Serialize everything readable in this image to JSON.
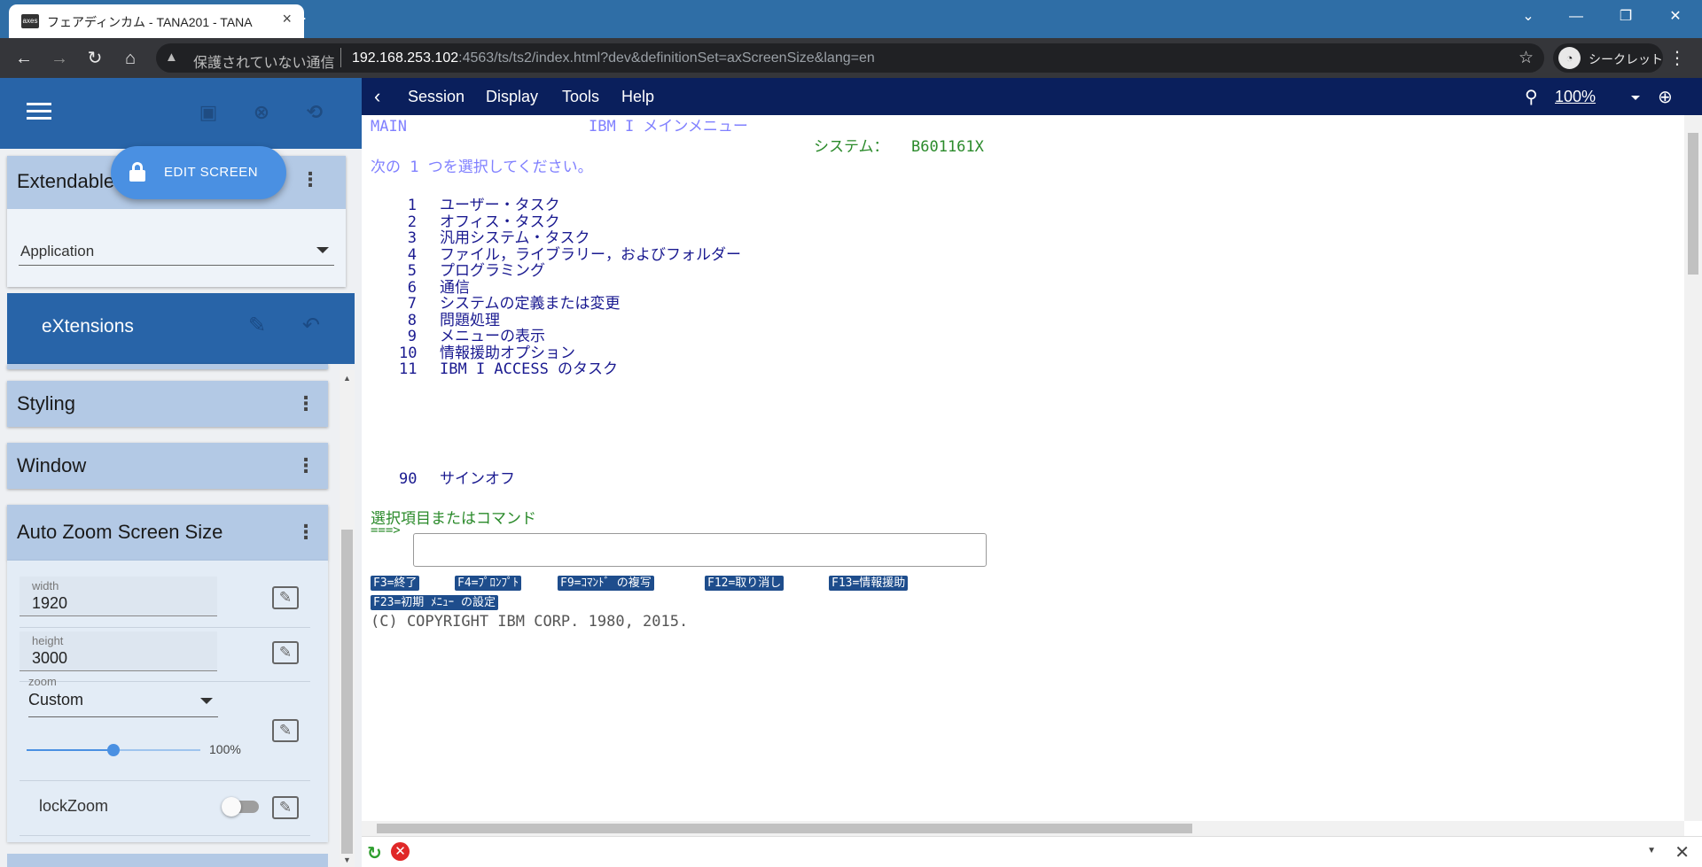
{
  "browser": {
    "tab_title": "フェアディンカム - TANA201 - TANA",
    "tab_favicon": "axes",
    "url_security": "保護されていない通信",
    "url_host": "192.168.253.102",
    "url_path": ":4563/ts/ts2/index.html?dev&definitionSet=axScreenSize&lang=en",
    "profile_label": "シークレット"
  },
  "left": {
    "edit_button": "EDIT SCREEN",
    "extendable_title": "Extendable",
    "application_select": "Application",
    "extensions_title": "eXtensions",
    "styling_title": "Styling",
    "window_title": "Window",
    "autozoom_title": "Auto Zoom Screen Size",
    "width_label": "width",
    "width_value": "1920",
    "height_label": "height",
    "height_value": "3000",
    "zoom_label": "zoom",
    "zoom_value": "Custom",
    "slider_value": "100%",
    "slider_fraction": 0.5,
    "lockzoom_label": "lockZoom",
    "lockzoom_on": false
  },
  "right": {
    "menu": [
      "Session",
      "Display",
      "Tools",
      "Help"
    ],
    "zoom": "100%"
  },
  "terminal": {
    "screen_id": "MAIN",
    "title": "IBM I メインメニュー",
    "system_label": "システム：",
    "system_name": "B601161X",
    "instruction": "次の 1 つを選択してください。",
    "options": [
      {
        "num": "1",
        "text": "ユーザー・タスク"
      },
      {
        "num": "2",
        "text": "オフィス・タスク"
      },
      {
        "num": "3",
        "text": "汎用システム・タスク"
      },
      {
        "num": "4",
        "text": "ファイル，ライブラリー，およびフォルダー"
      },
      {
        "num": "5",
        "text": "プログラミング"
      },
      {
        "num": "6",
        "text": "通信"
      },
      {
        "num": "7",
        "text": "システムの定義または変更"
      },
      {
        "num": "8",
        "text": "問題処理"
      },
      {
        "num": "9",
        "text": "メニューの表示"
      },
      {
        "num": "10",
        "text": "情報援助オプション"
      },
      {
        "num": "11",
        "text": "IBM I ACCESS のタスク"
      }
    ],
    "signoff_num": "90",
    "signoff_text": "サインオフ",
    "prompt_label": "選択項目またはコマンド",
    "prompt_arrow": "===>",
    "fkeys": [
      "F3=終了",
      "F4=ﾌﾟﾛﾝﾌﾟﾄ",
      "F9=ｺﾏﾝﾄﾞ の複写",
      "F12=取り消し",
      "F13=情報援助",
      "F23=初期 ﾒﾆｭｰ の設定"
    ],
    "copyright": "(C) COPYRIGHT IBM CORP. 1980, 2015."
  }
}
